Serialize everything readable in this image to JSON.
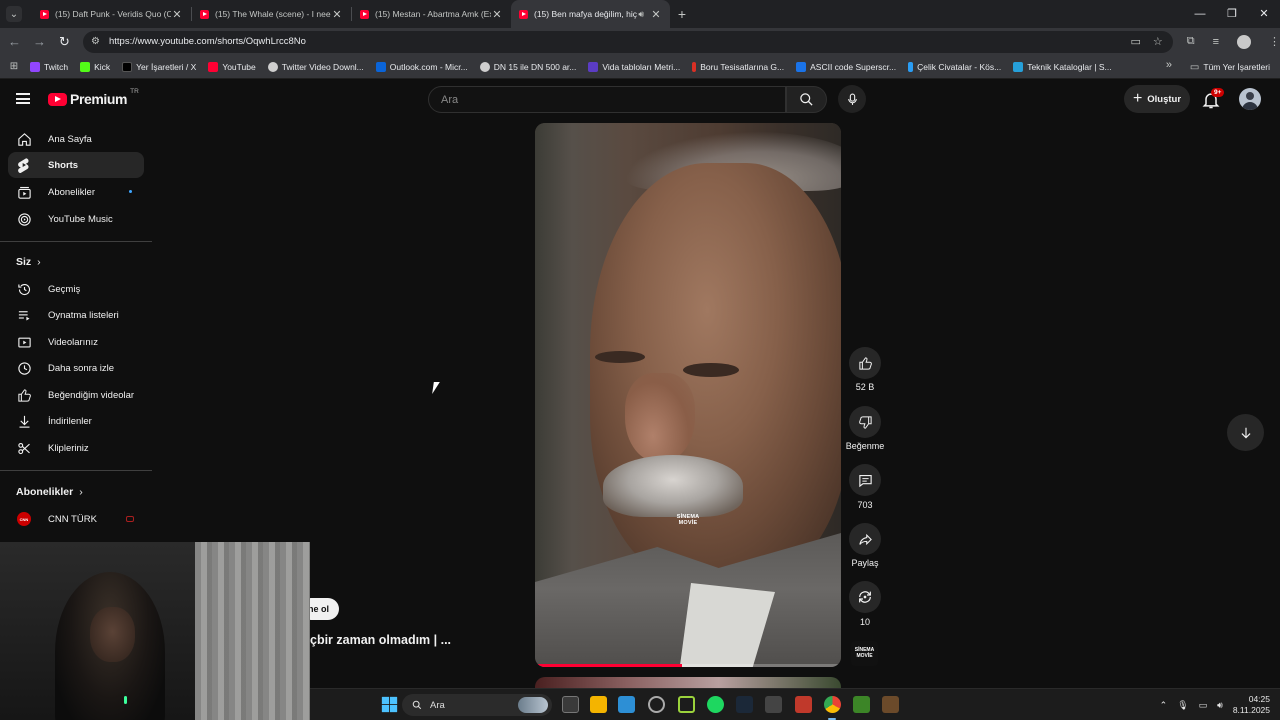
{
  "browser": {
    "tabs": [
      {
        "title": "(15) Daft Punk - Veridis Quo (O"
      },
      {
        "title": "(15) The Whale (scene) - I need"
      },
      {
        "title": "(15) Mestan - Abartma Amk (Ex"
      },
      {
        "title": "(15) Ben mafya değilim, hiç",
        "active": true,
        "audio": true
      }
    ],
    "url": "https://www.youtube.com/shorts/OqwhLrcc8No",
    "bookmarks": [
      {
        "label": "Twitch",
        "color": "#9146ff"
      },
      {
        "label": "Kick",
        "color": "#53fc18"
      },
      {
        "label": "Yer İşaretleri / X",
        "color": "#000000"
      },
      {
        "label": "YouTube",
        "color": "#ff0033"
      },
      {
        "label": "Twitter Video Downl...",
        "color": "#cfcfcf"
      },
      {
        "label": "Outlook.com - Micr...",
        "color": "#0a64d8"
      },
      {
        "label": "DN 15 ile DN 500 ar...",
        "color": "#cfcfcf"
      },
      {
        "label": "Vida tabloları Metri...",
        "color": "#5b3cc4"
      },
      {
        "label": "Boru Tesisatlarına G...",
        "color": "#d93025"
      },
      {
        "label": "ASCII code Superscr...",
        "color": "#1a73e8"
      },
      {
        "label": "Çelik Civatalar - Kös...",
        "color": "#2a9df4"
      },
      {
        "label": "Teknik Kataloglar | S...",
        "color": "#26a0da"
      }
    ],
    "all_bookmarks": "Tüm Yer İşaretleri"
  },
  "header": {
    "logo": "Premium",
    "region": "TR",
    "search_placeholder": "Ara",
    "create_label": "Oluştur",
    "notification_count": "9+"
  },
  "sidebar": {
    "main": [
      {
        "label": "Ana Sayfa",
        "icon": "home-icon"
      },
      {
        "label": "Shorts",
        "icon": "shorts-icon",
        "active": true
      },
      {
        "label": "Abonelikler",
        "icon": "subscriptions-icon"
      },
      {
        "label": "YouTube Music",
        "icon": "music-icon"
      }
    ],
    "you_heading": "Siz",
    "you": [
      {
        "label": "Geçmiş",
        "icon": "history-icon"
      },
      {
        "label": "Oynatma listeleri",
        "icon": "playlists-icon"
      },
      {
        "label": "Videolarınız",
        "icon": "your-videos-icon"
      },
      {
        "label": "Daha sonra izle",
        "icon": "watch-later-icon"
      },
      {
        "label": "Beğendiğim videolar",
        "icon": "liked-icon"
      },
      {
        "label": "İndirilenler",
        "icon": "downloads-icon"
      },
      {
        "label": "Klipleriniz",
        "icon": "clips-icon"
      }
    ],
    "subs_heading": "Abonelikler",
    "subs": [
      {
        "label": "CNN TÜRK",
        "icon": "cnn-turk-avatar"
      }
    ]
  },
  "short": {
    "watermark": "SİNEMA MOVİE",
    "progress": 0.48,
    "subscribe_partial": "ne ol",
    "title_partial": "çbir zaman olmadım | ...",
    "actions": {
      "likes": "52 B",
      "dislike": "Beğenme",
      "comments": "703",
      "share": "Paylaş",
      "remix": "10"
    },
    "channel_badge": "SİNEMA MOVİE"
  },
  "taskbar": {
    "search": "Ara",
    "time": "04:25",
    "date": "8.11.2025"
  }
}
